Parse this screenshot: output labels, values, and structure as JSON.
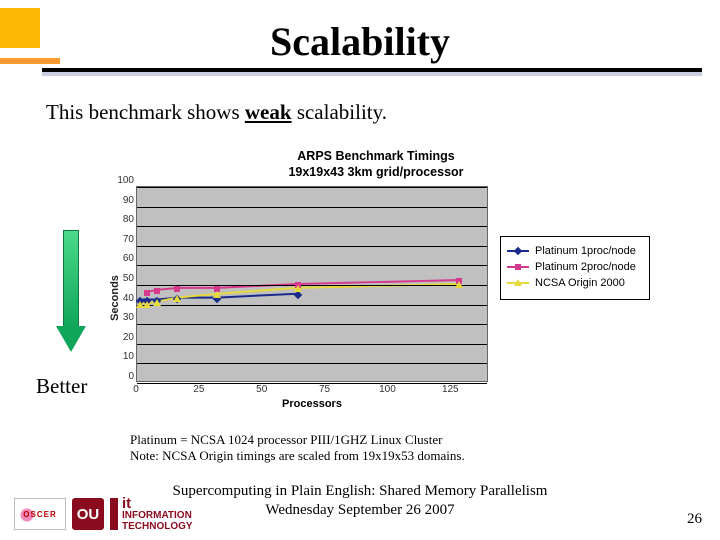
{
  "title": "Scalability",
  "body": {
    "prefix": "This benchmark shows ",
    "emph": "weak",
    "suffix": " scalability."
  },
  "arrow_label": "Better",
  "notes": {
    "line1": "Platinum = NCSA 1024 processor PIII/1GHZ Linux Cluster",
    "line2": "Note: NCSA Origin timings are scaled from 19x19x53 domains."
  },
  "footer": {
    "line1": "Supercomputing in Plain English: Shared Memory Parallelism",
    "line2": "Wednesday September 26 2007"
  },
  "page_number": "26",
  "logos": {
    "oscer": "OSCER",
    "ou": "OU",
    "it_line1": "INFORMATION",
    "it_line2": "TECHNOLOGY"
  },
  "chart_data": {
    "type": "line",
    "title_line1": "ARPS Benchmark Timings",
    "title_line2": "19x19x43 3km grid/processor",
    "xlabel": "Processors",
    "ylabel": "Seconds",
    "xlim": [
      0,
      140
    ],
    "ylim": [
      0,
      100
    ],
    "x_ticks": [
      0,
      25,
      50,
      75,
      100,
      125
    ],
    "y_ticks": [
      0,
      10,
      20,
      30,
      40,
      50,
      60,
      70,
      80,
      90,
      100
    ],
    "x": [
      1,
      4,
      8,
      16,
      32,
      64,
      128
    ],
    "series": [
      {
        "name": "Platinum 1proc/node",
        "color": "#1a2a8a",
        "marker": "diamond",
        "values": [
          42,
          42,
          42,
          43,
          43,
          45,
          null
        ]
      },
      {
        "name": "Platinum 2proc/node",
        "color": "#d63a8e",
        "marker": "square",
        "values": [
          null,
          46,
          47,
          48,
          48,
          50,
          52
        ]
      },
      {
        "name": "NCSA Origin 2000",
        "color": "#e6d93a",
        "marker": "triangle",
        "values": [
          40,
          40,
          41,
          43,
          45,
          48,
          50
        ]
      }
    ],
    "legend_position": "right"
  }
}
